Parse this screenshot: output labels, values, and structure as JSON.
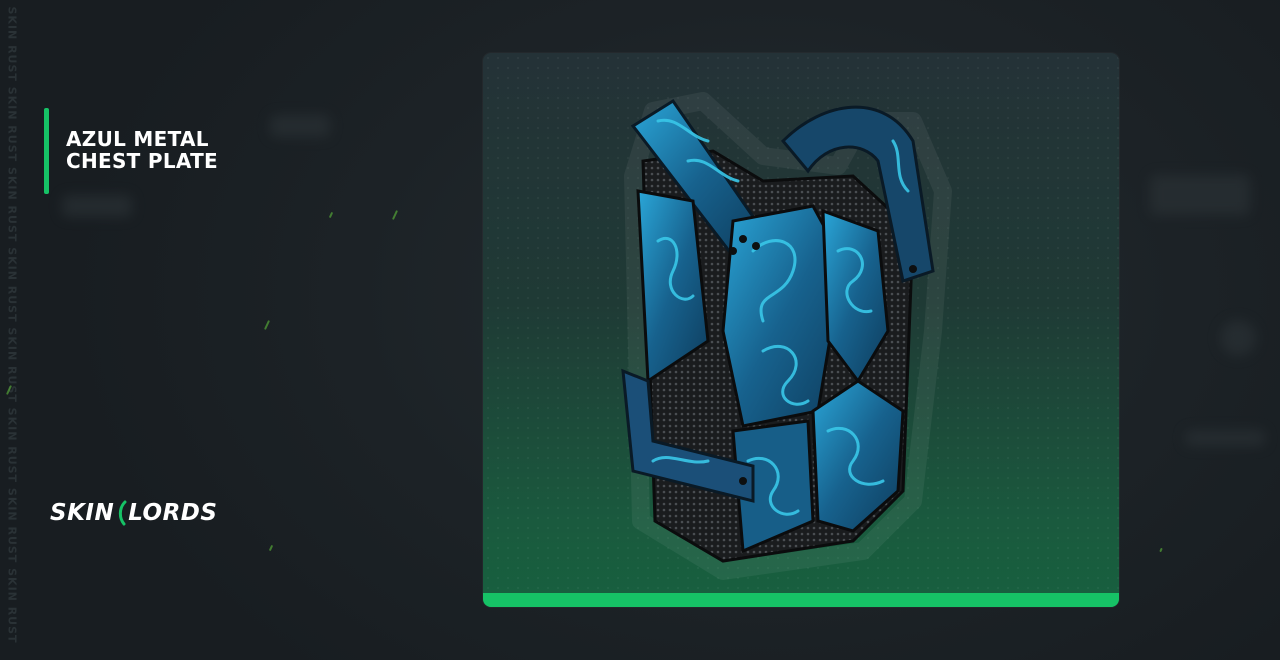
{
  "watermark": "SKIN RUST SKIN RUST SKIN RUST SKIN RUST SKIN RUST SKIN RUST SKIN RUST SKIN RUST",
  "title": {
    "line1": "AZUL METAL",
    "line2": "CHEST PLATE"
  },
  "brand": {
    "left": "SKIN",
    "right": "LORDS"
  },
  "colors": {
    "accent": "#16c266",
    "background": "#1e2428",
    "item_blue": "#1f8fc4"
  },
  "item": {
    "icon": "azul-metal-chest-plate-image"
  }
}
